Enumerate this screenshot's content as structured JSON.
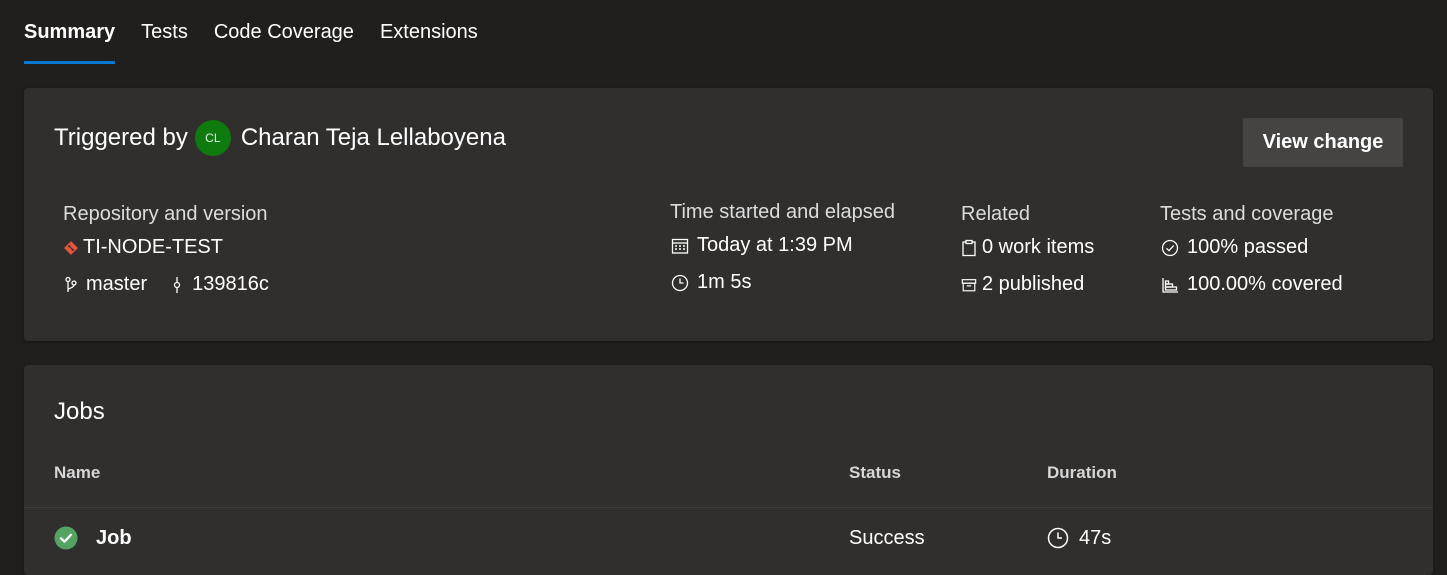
{
  "tabs": [
    {
      "label": "Summary",
      "active": true
    },
    {
      "label": "Tests",
      "active": false
    },
    {
      "label": "Code Coverage",
      "active": false
    },
    {
      "label": "Extensions",
      "active": false
    }
  ],
  "summary": {
    "triggered_by_label": "Triggered by",
    "avatar_initials": "CL",
    "user_name": "Charan Teja Lellaboyena",
    "view_change_label": "View change",
    "repository": {
      "heading": "Repository and version",
      "repo_name": "TI-NODE-TEST",
      "branch": "master",
      "commit": "139816c"
    },
    "time": {
      "heading": "Time started and elapsed",
      "started": "Today at 1:39 PM",
      "elapsed": "1m 5s"
    },
    "related": {
      "heading": "Related",
      "work_items": "0 work items",
      "published": "2 published"
    },
    "tests": {
      "heading": "Tests and coverage",
      "passed": "100% passed",
      "covered": "100.00% covered"
    }
  },
  "jobs": {
    "title": "Jobs",
    "columns": {
      "name": "Name",
      "status": "Status",
      "duration": "Duration"
    },
    "rows": [
      {
        "name": "Job",
        "status": "Success",
        "duration": "47s"
      }
    ]
  },
  "colors": {
    "background": "#201f1e",
    "card": "#302f2e",
    "accent": "#0078d4",
    "avatar": "#0f7b0f",
    "success": "#55a362",
    "git": "#e8543f"
  },
  "icons": {
    "repo": "git-diamond-icon",
    "branch": "branch-icon",
    "commit": "commit-icon",
    "calendar": "calendar-icon",
    "clock": "clock-icon",
    "work_items": "clipboard-icon",
    "published": "artifact-icon",
    "passed": "check-circle-icon",
    "coverage": "bar-chart-icon",
    "success": "success-check-icon"
  }
}
